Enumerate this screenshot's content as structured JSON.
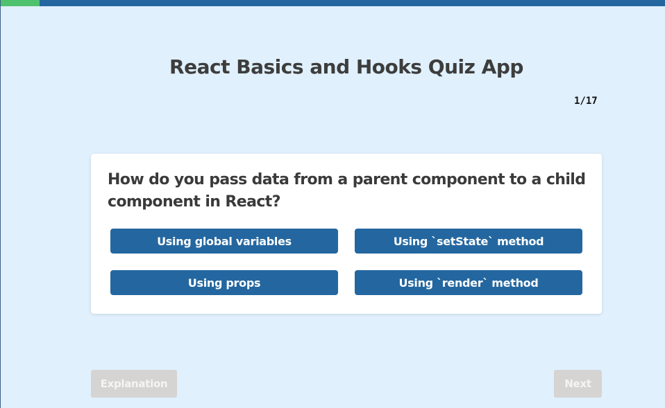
{
  "progress": {
    "current": 1,
    "total": 17,
    "fraction": 0.0589,
    "color_fill": "#4fc26e",
    "color_track": "#2467a0"
  },
  "header": {
    "title": "React Basics and Hooks Quiz App"
  },
  "counter": {
    "label": "1/17"
  },
  "question": {
    "text": "How do you pass data from a parent component to a child component in React?",
    "answers": [
      {
        "label": "Using global variables"
      },
      {
        "label": "Using `setState` method"
      },
      {
        "label": "Using props"
      },
      {
        "label": "Using `render` method"
      }
    ]
  },
  "footer": {
    "explanation_label": "Explanation",
    "next_label": "Next"
  },
  "colors": {
    "background": "#e0f0fd",
    "accent": "#2467a0",
    "disabled": "#d6d4d2"
  }
}
